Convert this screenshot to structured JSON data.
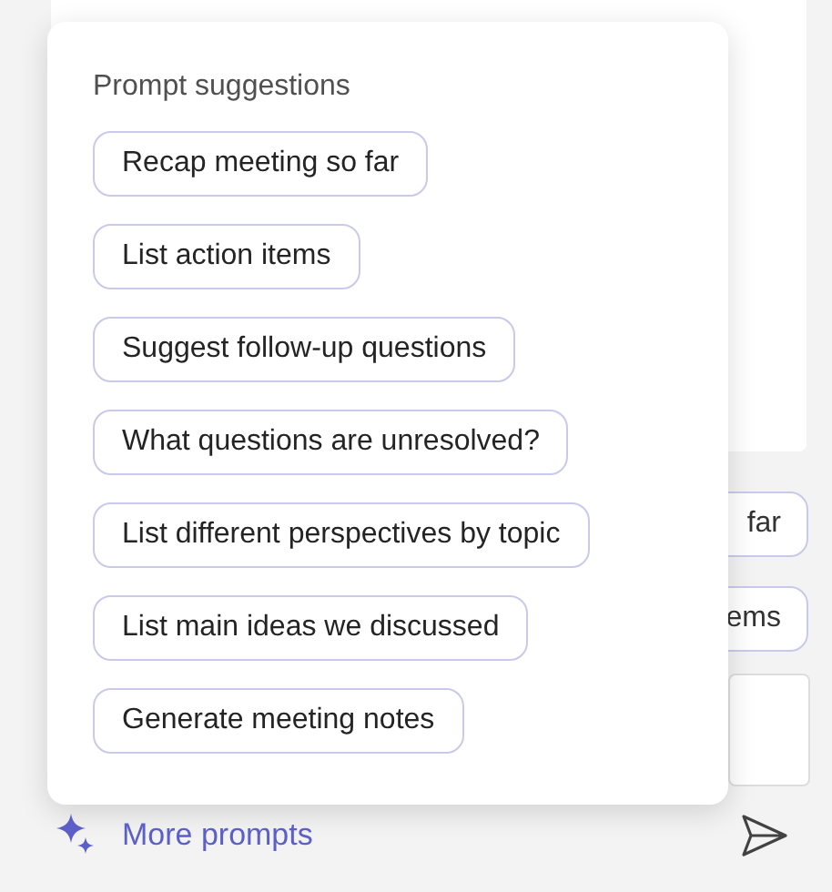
{
  "background": {
    "chips": [
      "far",
      "ems"
    ]
  },
  "popup": {
    "title": "Prompt suggestions",
    "prompts": [
      {
        "label": "Recap meeting so far"
      },
      {
        "label": "List action items"
      },
      {
        "label": "Suggest follow-up questions"
      },
      {
        "label": "What questions are unresolved?"
      },
      {
        "label": "List different perspectives by topic"
      },
      {
        "label": "List main ideas we discussed"
      },
      {
        "label": "Generate meeting notes"
      }
    ]
  },
  "footer": {
    "more_prompts": "More prompts"
  }
}
